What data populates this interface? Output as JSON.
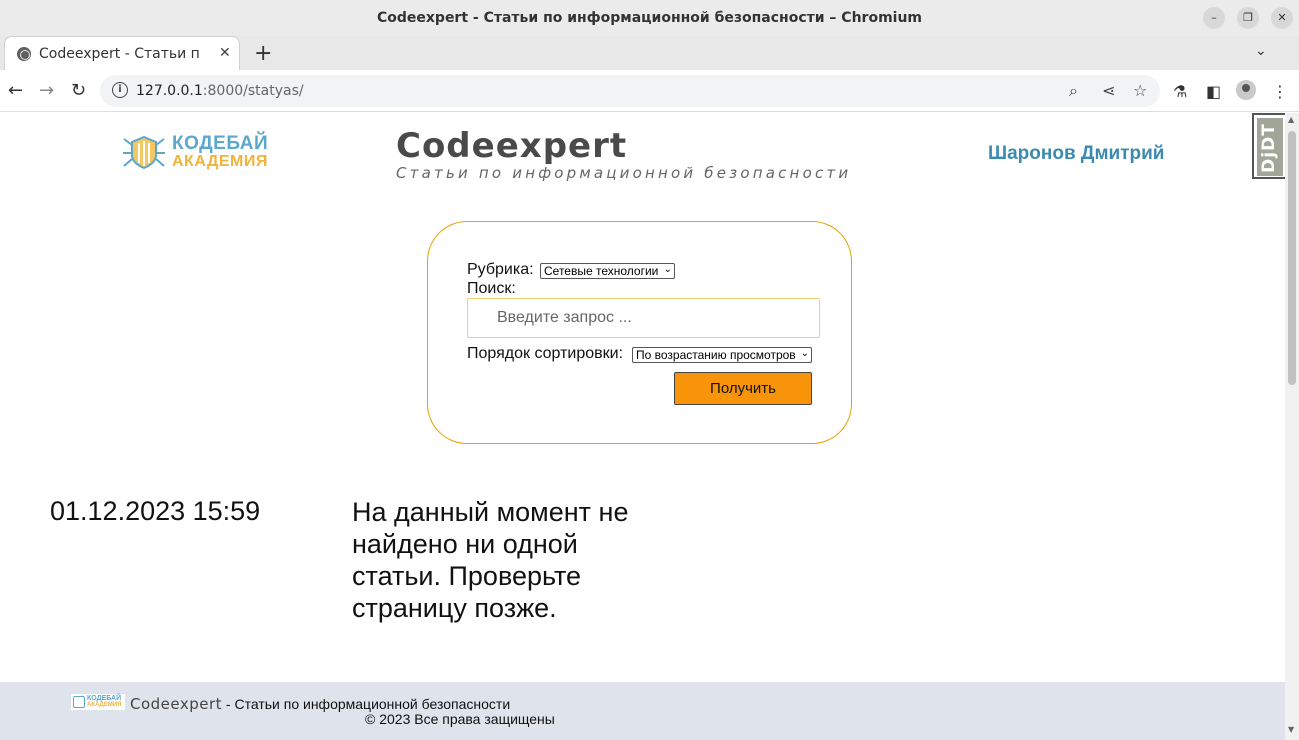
{
  "window": {
    "title": "Codeexpert - Статьи по информационной безопасности – Chromium",
    "minimize_icon": "minimize-icon",
    "restore_icon": "restore-icon",
    "close_icon": "close-icon"
  },
  "tabs": [
    {
      "label": "Codeexpert - Статьи по информационной безопасности",
      "active": true
    }
  ],
  "address_bar": {
    "url_host": "127.0.0.1",
    "url_rest": ":8000/statyas/"
  },
  "header": {
    "logo_line1": "КОДЕБАЙ",
    "logo_line2": "АКАДЕМИЯ",
    "site_title": "Codeexpert",
    "site_subtitle": "Статьи по информационной безопасности",
    "user_name": "Шаронов Дмитрий",
    "debug_toolbar_label": "DjDT"
  },
  "filter": {
    "category_label": "Рубрика:",
    "category_value": "Сетевые технологии",
    "search_label": "Поиск:",
    "search_placeholder": "Введите запрос ...",
    "search_value": "",
    "sort_label": "Порядок сортировки:",
    "sort_value": "По возрастанию просмотров",
    "submit_label": "Получить"
  },
  "content": {
    "datetime": "01.12.2023 15:59",
    "empty_message": "На данный момент не найдено ни одной статьи. Проверьте страницу позже."
  },
  "footer": {
    "logo_line1": "КОДЕБАЙ",
    "logo_line2": "АКАДЕМИЯ",
    "site_name": "Codeexpert",
    "site_tagline": " - Статьи по информационной безопасности",
    "copyright": "© 2023 Все права защищены"
  },
  "colors": {
    "accent_orange": "#f7940a",
    "box_border": "#e6a000",
    "user_link": "#3b8ab0",
    "footer_bg": "#dfe4ec"
  }
}
